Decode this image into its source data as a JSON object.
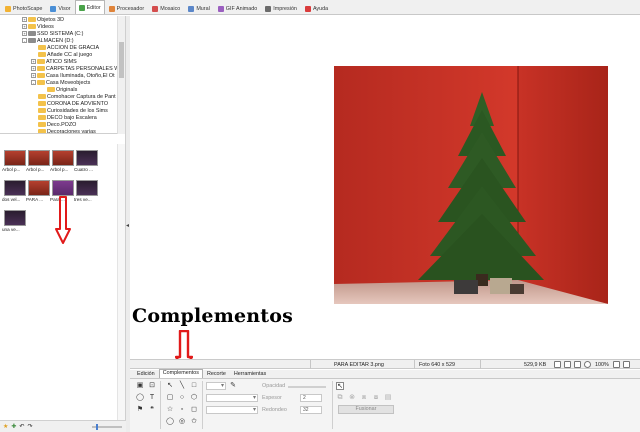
{
  "tabs": [
    {
      "label": "PhotoScape",
      "icon": "photoscape-icon",
      "color": "#f2b233",
      "active": false
    },
    {
      "label": "Visor",
      "icon": "viewer-icon",
      "color": "#4a8fd6",
      "active": false
    },
    {
      "label": "Editor",
      "icon": "editor-icon",
      "color": "#4aa34a",
      "active": true
    },
    {
      "label": "Procesador",
      "icon": "batch-icon",
      "color": "#e0843a",
      "active": false
    },
    {
      "label": "Mosaico",
      "icon": "page-icon",
      "color": "#d44d4d",
      "active": false
    },
    {
      "label": "Mural",
      "icon": "combine-icon",
      "color": "#5b87c9",
      "active": false
    },
    {
      "label": "GIF Animado",
      "icon": "gif-icon",
      "color": "#9b5fc0",
      "active": false
    },
    {
      "label": "Impresión",
      "icon": "print-icon",
      "color": "#6b6b6b",
      "active": false
    },
    {
      "label": "Ayuda",
      "icon": "help-icon",
      "color": "#d93b3b",
      "active": false
    }
  ],
  "tree": [
    {
      "label": "Objetos 3D",
      "indent": 0,
      "type": "folder",
      "expander": "+"
    },
    {
      "label": "Vídeos",
      "indent": 0,
      "type": "folder",
      "expander": "+"
    },
    {
      "label": "SSD SISTEMA (C:)",
      "indent": 0,
      "type": "drive",
      "expander": "+"
    },
    {
      "label": "ALMACEN (D:)",
      "indent": 0,
      "type": "drive",
      "expander": "-"
    },
    {
      "label": "ACCION DE GRACIA",
      "indent": 1,
      "type": "folder",
      "expander": ""
    },
    {
      "label": "Añade CC al juego",
      "indent": 1,
      "type": "folder",
      "expander": ""
    },
    {
      "label": "ATICO SIMS",
      "indent": 1,
      "type": "folder",
      "expander": "+"
    },
    {
      "label": "CARPETAS PERSONALES W",
      "indent": 1,
      "type": "folder",
      "expander": "+"
    },
    {
      "label": "Casa Iluminada, Otoño,El Ot",
      "indent": 1,
      "type": "folder",
      "expander": "+"
    },
    {
      "label": "Casa Moveobjects",
      "indent": 1,
      "type": "folder",
      "expander": "-"
    },
    {
      "label": "Originals",
      "indent": 2,
      "type": "folder",
      "expander": ""
    },
    {
      "label": "Comohacer Captura de Pant",
      "indent": 1,
      "type": "folder",
      "expander": ""
    },
    {
      "label": "CORONA DE ADVIENTO",
      "indent": 1,
      "type": "folder",
      "expander": ""
    },
    {
      "label": "Curiosidades de los Sims",
      "indent": 1,
      "type": "folder",
      "expander": ""
    },
    {
      "label": "DECO bajo Escalera",
      "indent": 1,
      "type": "folder",
      "expander": ""
    },
    {
      "label": "Deco.POZO",
      "indent": 1,
      "type": "folder",
      "expander": ""
    },
    {
      "label": "Decoraciones varias",
      "indent": 1,
      "type": "folder",
      "expander": ""
    }
  ],
  "thumbnails": [
    {
      "caption": "Arbol p...",
      "style": "img-red"
    },
    {
      "caption": "Arbol p...",
      "style": "img-red"
    },
    {
      "caption": "Arbol p...",
      "style": "img-red"
    },
    {
      "caption": "Cuatro ...",
      "style": "img-dark"
    },
    {
      "caption": "dos vel...",
      "style": "img-dark"
    },
    {
      "caption": "PARA ...",
      "style": "img-red"
    },
    {
      "caption": "Para ...",
      "style": "img-purple"
    },
    {
      "caption": "tres ve...",
      "style": "img-dark"
    },
    {
      "caption": "una ve...",
      "style": "img-dark"
    }
  ],
  "heading": "Complementos",
  "status": {
    "filename": "PARA EDITAR  3.png",
    "photo_size": "Foto 640 x 529",
    "file_size": "529,9 KB",
    "zoom": "100%"
  },
  "tool_tabs": [
    {
      "label": "Edición",
      "active": false
    },
    {
      "label": "Complementos",
      "active": true
    },
    {
      "label": "Recorte",
      "active": false
    },
    {
      "label": "Herramientas",
      "active": false
    }
  ],
  "properties": {
    "opacity_label": "Opacidad",
    "thickness_label": "Espesor",
    "thickness_value": "2",
    "rounded_label": "Redondeo",
    "rounded_value": "32",
    "merge_label": "Fusionar"
  },
  "colors": {
    "annotation_red": "#e11a1a",
    "wall_red": "#c93226",
    "tree_green": "#2e5a24"
  }
}
